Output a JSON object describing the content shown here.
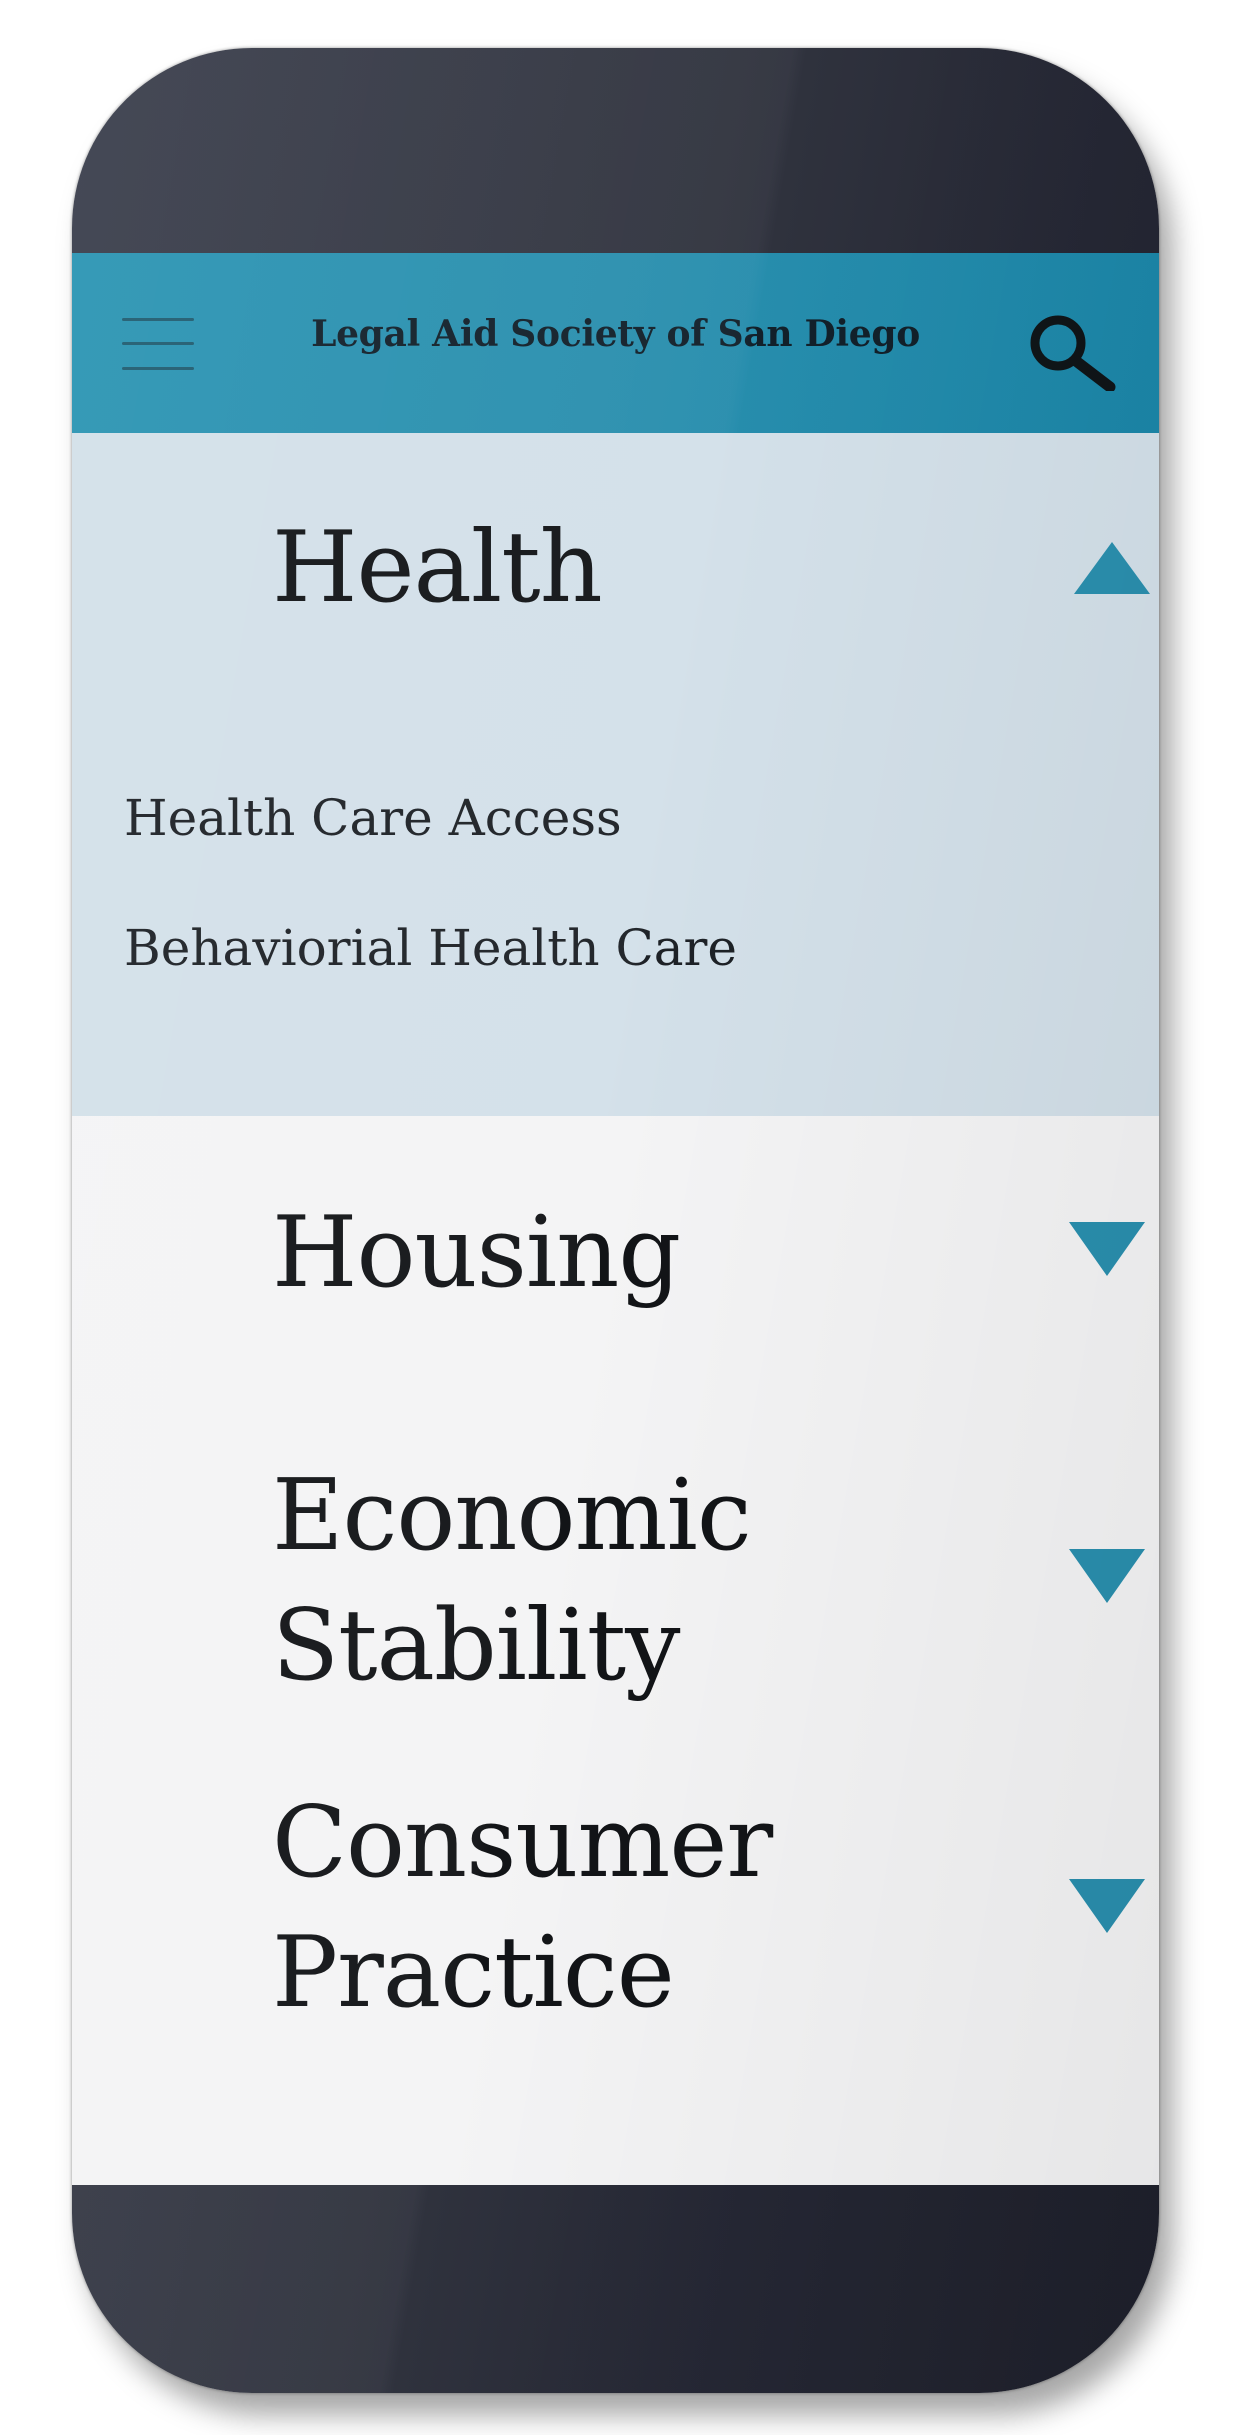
{
  "app": {
    "title": "Legal Aid Society of San Diego",
    "accent_color": "#2a8fae",
    "icons": {
      "menu": "hamburger-icon",
      "search": "search-icon",
      "expanded": "triangle-up-icon",
      "collapsed": "triangle-down-icon"
    }
  },
  "sections": [
    {
      "title_lines": [
        "Health"
      ],
      "expanded": true,
      "items": [
        "Health Care Access",
        "Behaviorial Health Care"
      ]
    },
    {
      "title_lines": [
        "Housing"
      ],
      "expanded": false
    },
    {
      "title_lines": [
        "Economic",
        "Stability"
      ],
      "expanded": false
    },
    {
      "title_lines": [
        "Consumer",
        "Practice"
      ],
      "expanded": false
    }
  ]
}
